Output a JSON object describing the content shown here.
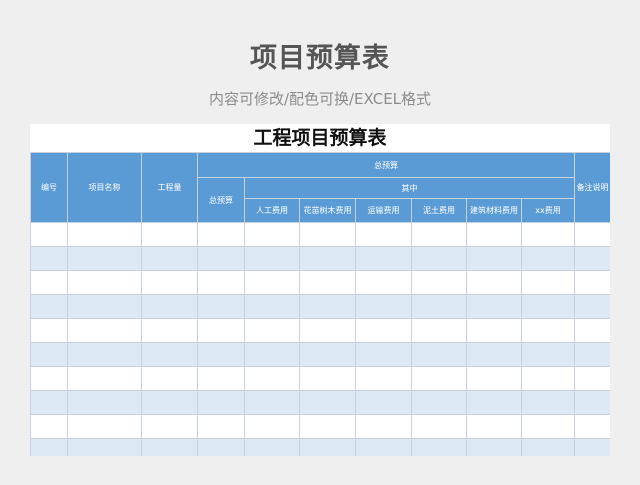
{
  "header": {
    "title": "项目预算表",
    "subtitle": "内容可修改/配色可换/EXCEL格式"
  },
  "sheet": {
    "title": "工程项目预算表",
    "columns": {
      "number": "编号",
      "project_name": "项目名称",
      "quantity": "工程量",
      "total_budget_group": "总预算",
      "total_budget": "总预算",
      "of_which": "其中",
      "sub": [
        "人工费用",
        "花苗树木费用",
        "运输费用",
        "泥土费用",
        "建筑材料费用",
        "xx费用"
      ],
      "remarks": "备注说明"
    },
    "row_count": 10
  },
  "colors": {
    "header_bg": "#5b9bd5",
    "row_alt_bg": "#dce9f5",
    "border": "#c6d2e0"
  }
}
